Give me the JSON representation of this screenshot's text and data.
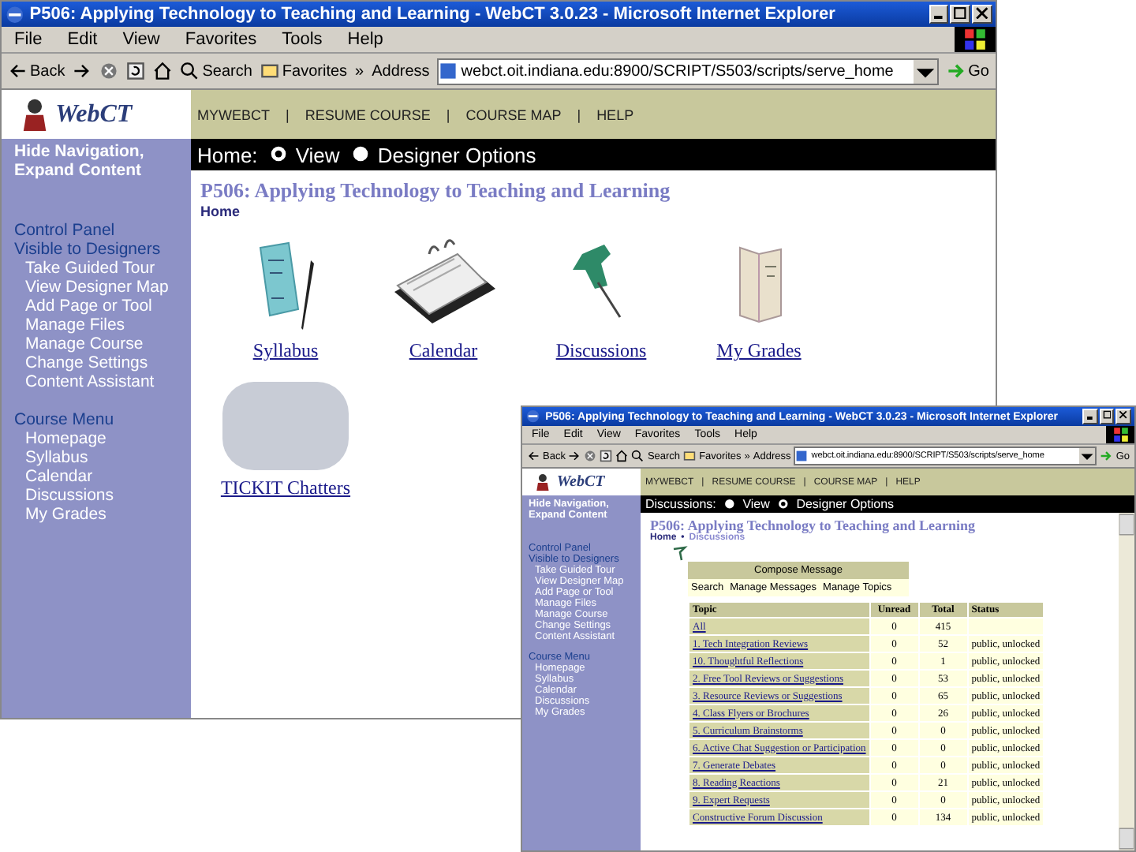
{
  "windows": [
    {
      "kind": "home",
      "title": "P506: Applying Technology to Teaching and Learning - WebCT 3.0.23 - Microsoft Internet Explorer",
      "menu": [
        "File",
        "Edit",
        "View",
        "Favorites",
        "Tools",
        "Help"
      ],
      "toolbar": {
        "back": "Back",
        "search": "Search",
        "favorites": "Favorites",
        "more": "»",
        "address_label": "Address",
        "address": "webct.oit.indiana.edu:8900/SCRIPT/S503/scripts/serve_home",
        "go": "Go"
      },
      "logo": "WebCT",
      "top_nav": [
        "MYWEBCT",
        "RESUME COURSE",
        "COURSE MAP",
        "HELP"
      ],
      "nav_separator": "|",
      "sidebar": {
        "toggle": "Hide Navigation, Expand Content",
        "sections": [
          {
            "headings": [
              "Control Panel",
              "Visible to Designers"
            ],
            "items": [
              "Take Guided Tour",
              "View Designer Map",
              "Add Page or Tool",
              "Manage Files",
              "Manage Course",
              "Change Settings",
              "Content Assistant"
            ]
          },
          {
            "headings": [
              "Course Menu"
            ],
            "items": [
              "Homepage",
              "Syllabus",
              "Calendar",
              "Discussions",
              "My Grades"
            ]
          }
        ]
      },
      "mode_bar": {
        "location": "Home:",
        "options": [
          {
            "label": "View",
            "selected": true
          },
          {
            "label": "Designer Options",
            "selected": false
          }
        ]
      },
      "heading": "P506: Applying Technology to Teaching and Learning",
      "breadcrumb": [
        "Home"
      ],
      "tools": [
        {
          "label": "Syllabus"
        },
        {
          "label": "Calendar"
        },
        {
          "label": "Discussions"
        },
        {
          "label": "My Grades"
        },
        {
          "label": "TICKIT Chatters"
        }
      ]
    },
    {
      "kind": "discussions",
      "title": "P506: Applying Technology to Teaching and Learning - WebCT 3.0.23 - Microsoft Internet Explorer",
      "menu": [
        "File",
        "Edit",
        "View",
        "Favorites",
        "Tools",
        "Help"
      ],
      "toolbar": {
        "back": "Back",
        "search": "Search",
        "favorites": "Favorites",
        "more": "»",
        "address_label": "Address",
        "address": "webct.oit.indiana.edu:8900/SCRIPT/S503/scripts/serve_home",
        "go": "Go"
      },
      "logo": "WebCT",
      "top_nav": [
        "MYWEBCT",
        "RESUME COURSE",
        "COURSE MAP",
        "HELP"
      ],
      "nav_separator": "|",
      "sidebar": {
        "toggle": "Hide Navigation, Expand Content",
        "sections": [
          {
            "headings": [
              "Control Panel",
              "Visible to Designers"
            ],
            "items": [
              "Take Guided Tour",
              "View Designer Map",
              "Add Page or Tool",
              "Manage Files",
              "Manage Course",
              "Change Settings",
              "Content Assistant"
            ]
          },
          {
            "headings": [
              "Course Menu"
            ],
            "items": [
              "Homepage",
              "Syllabus",
              "Calendar",
              "Discussions",
              "My Grades"
            ]
          }
        ]
      },
      "mode_bar": {
        "location": "Discussions:",
        "options": [
          {
            "label": "View",
            "selected": false
          },
          {
            "label": "Designer Options",
            "selected": true
          }
        ]
      },
      "heading": "P506: Applying Technology to Teaching and Learning",
      "breadcrumb": [
        "Home",
        "Discussions"
      ],
      "breadcrumb_separator": "•",
      "compose": "Compose Message",
      "actions": [
        "Search",
        "Manage Messages",
        "Manage Topics"
      ],
      "table": {
        "columns": [
          "Topic",
          "Unread",
          "Total",
          "Status"
        ],
        "rows": [
          {
            "topic": "All",
            "unread": "0",
            "total": "415"
          },
          {
            "topic": "1. Tech Integration Reviews",
            "unread": "0",
            "total": "52",
            "status": "public, unlocked"
          },
          {
            "topic": "10. Thoughtful Reflections",
            "unread": "0",
            "total": "1",
            "status": "public, unlocked"
          },
          {
            "topic": "2. Free Tool Reviews or Suggestions",
            "unread": "0",
            "total": "53",
            "status": "public, unlocked"
          },
          {
            "topic": "3. Resource Reviews or Suggestions",
            "unread": "0",
            "total": "65",
            "status": "public, unlocked"
          },
          {
            "topic": "4. Class Flyers or Brochures",
            "unread": "0",
            "total": "26",
            "status": "public, unlocked"
          },
          {
            "topic": "5. Curriculum Brainstorms",
            "unread": "0",
            "total": "0",
            "status": "public, unlocked"
          },
          {
            "topic": "6. Active Chat Suggestion or Participation",
            "unread": "0",
            "total": "0",
            "status": "public, unlocked"
          },
          {
            "topic": "7. Generate Debates",
            "unread": "0",
            "total": "0",
            "status": "public, unlocked"
          },
          {
            "topic": "8. Reading Reactions",
            "unread": "0",
            "total": "21",
            "status": "public, unlocked"
          },
          {
            "topic": "9. Expert Requests",
            "unread": "0",
            "total": "0",
            "status": "public, unlocked"
          },
          {
            "topic": "Constructive Forum Discussion",
            "unread": "0",
            "total": "134",
            "status": "public, unlocked"
          }
        ]
      }
    }
  ]
}
